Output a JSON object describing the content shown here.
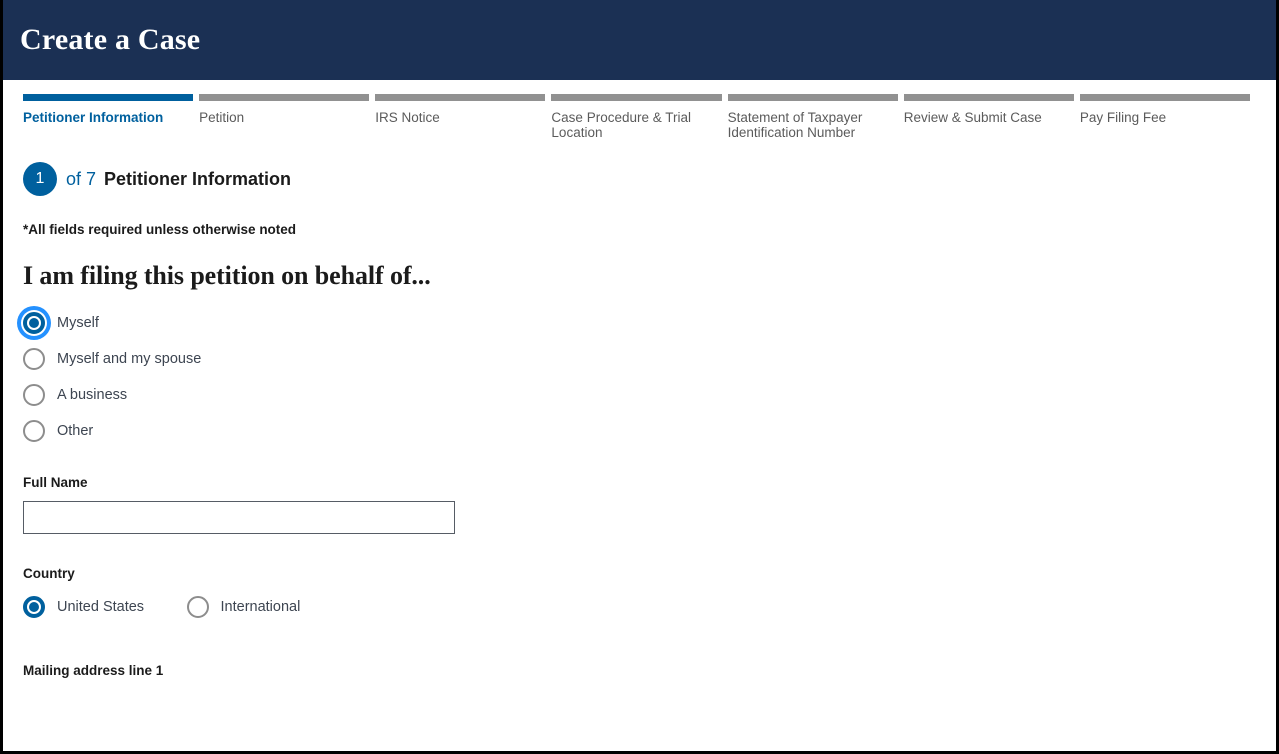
{
  "header": {
    "title": "Create a Case"
  },
  "progress": {
    "steps": [
      {
        "label": "Petitioner Information",
        "state": "current"
      },
      {
        "label": "Petition",
        "state": "upcoming"
      },
      {
        "label": "IRS Notice",
        "state": "upcoming"
      },
      {
        "label": "Case Procedure & Trial Location",
        "state": "upcoming"
      },
      {
        "label": "Statement of Taxpayer Identification Number",
        "state": "upcoming"
      },
      {
        "label": "Review & Submit Case",
        "state": "upcoming"
      },
      {
        "label": "Pay Filing Fee",
        "state": "upcoming"
      }
    ]
  },
  "step": {
    "number": "1",
    "of_text": "of 7",
    "title": "Petitioner Information",
    "required_note": "*All fields required unless otherwise noted"
  },
  "behalf": {
    "question": "I am filing this petition on behalf of...",
    "options": [
      {
        "label": "Myself",
        "selected": true,
        "focused": true
      },
      {
        "label": "Myself and my spouse",
        "selected": false,
        "focused": false
      },
      {
        "label": "A business",
        "selected": false,
        "focused": false
      },
      {
        "label": "Other",
        "selected": false,
        "focused": false
      }
    ]
  },
  "full_name": {
    "label": "Full Name",
    "value": "",
    "placeholder": ""
  },
  "country": {
    "label": "Country",
    "options": [
      {
        "label": "United States",
        "selected": true
      },
      {
        "label": "International",
        "selected": false
      }
    ]
  },
  "mailing": {
    "address_line_1_label": "Mailing address line 1"
  },
  "colors": {
    "header_navy": "#1b3054",
    "accent_blue": "#00609e",
    "focus_blue": "#2491ff",
    "bar_gray": "#919191"
  }
}
